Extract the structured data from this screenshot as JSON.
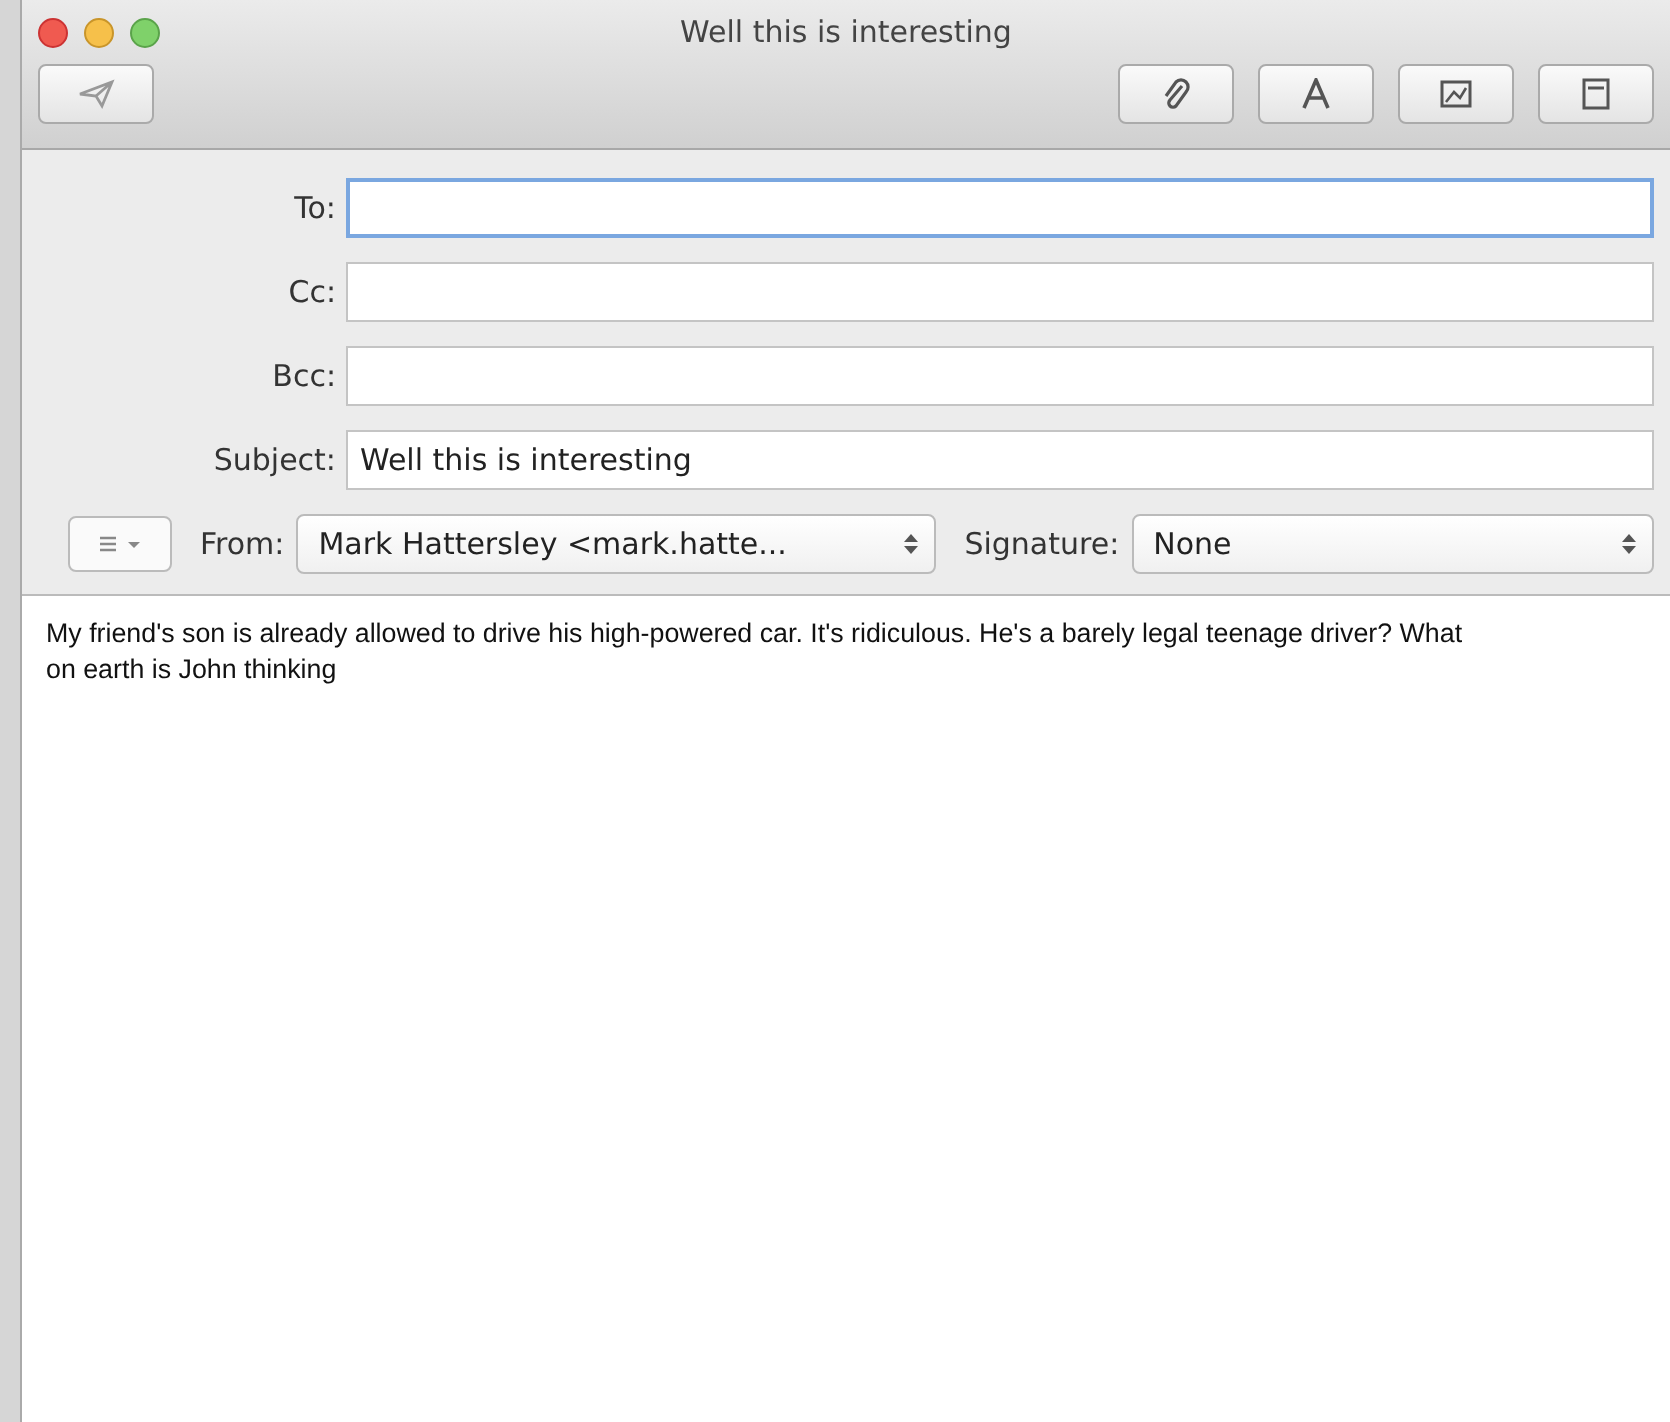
{
  "window": {
    "title": "Well this is interesting"
  },
  "fields": [
    {
      "label": "To:",
      "focused": true
    },
    {
      "label": "Cc:",
      "focused": false
    },
    {
      "label": "Bcc:",
      "focused": false
    },
    {
      "label": "Subject:",
      "value": "Well this is interesting",
      "focused": false
    }
  ],
  "from": {
    "label": "From:",
    "value": "Mark Hattersley <mark.hatte..."
  },
  "signature": {
    "label": "Signature:",
    "value": "None"
  },
  "body": "My friend's son is already allowed to drive his high-powered car. It's ridiculous. He's a barely legal teenage driver? What on earth is John thinking"
}
